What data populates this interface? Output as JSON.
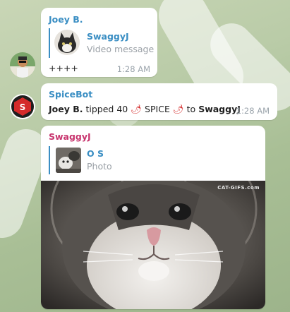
{
  "messages": [
    {
      "sender": "Joey B.",
      "sender_color": "#3a8ec3",
      "reply": {
        "name": "SwaggyJ",
        "subtitle": "Video message"
      },
      "text": "++++",
      "time": "1:28 AM"
    },
    {
      "sender": "SpiceBot",
      "sender_color": "#3a8ec3",
      "text_parts": {
        "actor": "Joey B.",
        "middle": " tipped 40 ",
        "pepper1": "🌶",
        "spice": " SPICE ",
        "pepper2": "🌶",
        "to": " to ",
        "target": "SwaggyJ"
      },
      "time": "1:28 AM"
    },
    {
      "sender": "SwaggyJ",
      "sender_color": "#c8356e",
      "reply": {
        "name": "O S",
        "subtitle": "Photo"
      },
      "media_watermark": "CAT-GIFS.com"
    }
  ],
  "colors": {
    "accent": "#3a8ec3",
    "pink": "#c8356e",
    "time": "#9aa3ab"
  }
}
